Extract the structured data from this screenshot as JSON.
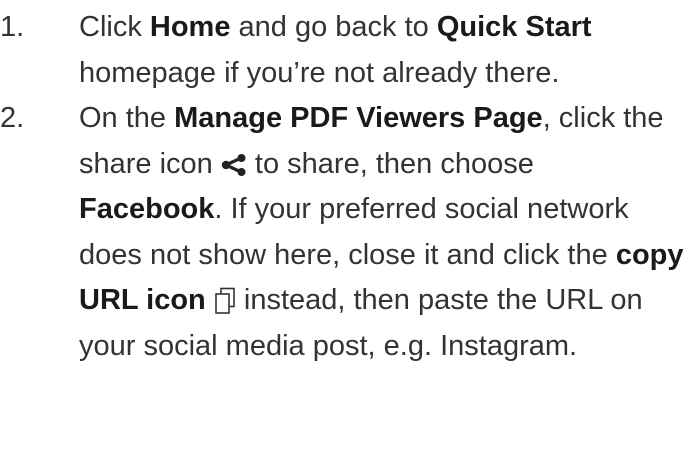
{
  "steps": [
    {
      "number": "1.",
      "t1": "Click ",
      "b1": "Home",
      "t2": " and go back to ",
      "b2": "Quick Start",
      "t3": " homepage if you’re not already there."
    },
    {
      "number": "2.",
      "t1": "On the ",
      "b1": "Manage PDF Viewers Page",
      "t2": ", click the share icon ",
      "t3": " to share, then choose ",
      "b2": "Facebook",
      "t4": ". If your preferred social network does not show here, close it and click the ",
      "b3": "copy URL icon",
      "t5": " instead, then paste the URL on your social media post, e.g. Instagram."
    }
  ],
  "icons": {
    "share": "share-icon",
    "copy": "copy-icon"
  },
  "colors": {
    "text": "#333333",
    "bold": "#1a1a1a"
  }
}
